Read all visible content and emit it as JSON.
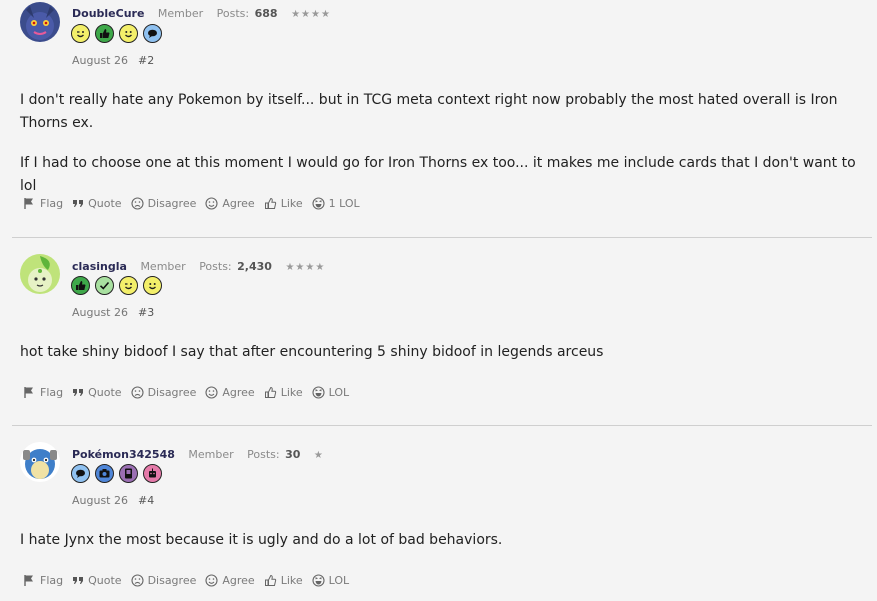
{
  "posts": [
    {
      "username": "DoubleCure",
      "role": "Member",
      "posts_label": "Posts:",
      "posts_count": "688",
      "stars": "★★★★",
      "badges": [
        "wink-badge",
        "thumbs-up-badge",
        "smile-badge",
        "comment-badge"
      ],
      "date": "August 26",
      "number": "#2",
      "body": [
        "I don't really hate any Pokemon by itself... but in TCG meta context right now probably the most hated overall is Iron Thorns ex.",
        "If I had to choose one at this moment I would go for Iron Thorns ex too... it makes me include cards that I don't want to lol"
      ],
      "actions": {
        "flag": "Flag",
        "quote": "Quote",
        "disagree": "Disagree",
        "agree": "Agree",
        "like": "Like",
        "lol": "1 LOL"
      }
    },
    {
      "username": "clasingla",
      "role": "Member",
      "posts_label": "Posts:",
      "posts_count": "2,430",
      "stars": "★★★★",
      "badges": [
        "thumbs-up-badge",
        "check-badge",
        "wink-badge",
        "smile-badge"
      ],
      "date": "August 26",
      "number": "#3",
      "body": [
        "hot take shiny bidoof I say that after encountering 5 shiny bidoof in legends arceus"
      ],
      "actions": {
        "flag": "Flag",
        "quote": "Quote",
        "disagree": "Disagree",
        "agree": "Agree",
        "like": "Like",
        "lol": "LOL"
      }
    },
    {
      "username": "Pokémon342548",
      "role": "Member",
      "posts_label": "Posts:",
      "posts_count": "30",
      "stars": "★",
      "badges": [
        "comment-badge",
        "camera-badge",
        "card-badge",
        "robot-badge"
      ],
      "date": "August 26",
      "number": "#4",
      "body": [
        "I hate Jynx the most because it is ugly and do a lot of bad behaviors."
      ],
      "actions": {
        "flag": "Flag",
        "quote": "Quote",
        "disagree": "Disagree",
        "agree": "Agree",
        "like": "Like",
        "lol": "LOL"
      }
    }
  ],
  "colors": {
    "username": "#2a2a55",
    "badge_yellow": "#f3ef6a",
    "badge_green": "#3ea84a",
    "badge_blue": "#8fc1f0",
    "badge_purple": "#9b6fb3",
    "badge_pink": "#e57aa9"
  }
}
